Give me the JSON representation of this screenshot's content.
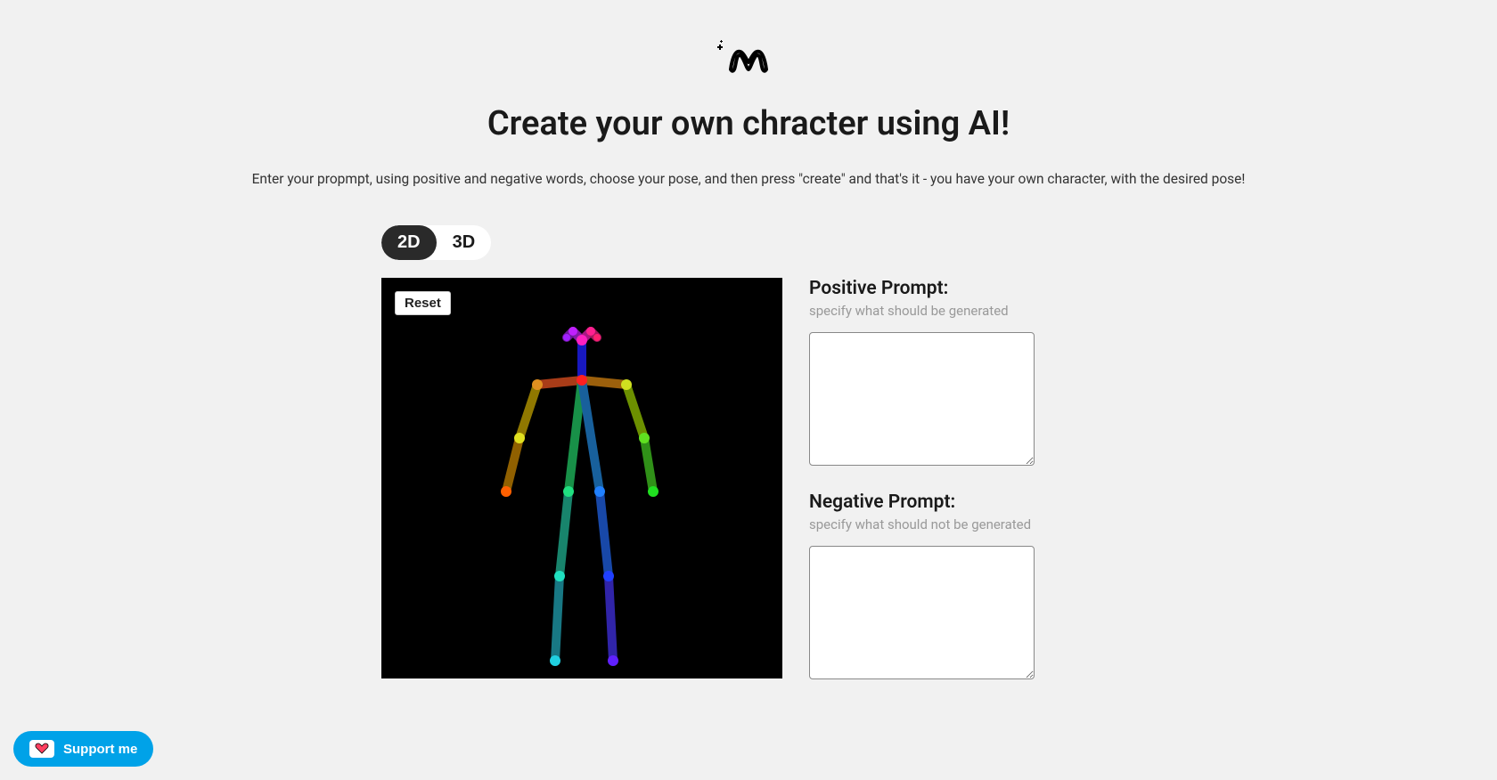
{
  "header": {
    "title": "Create your own chracter using AI!",
    "subtitle": "Enter your propmpt, using positive and negative words, choose your pose, and then press \"create\" and that's it - you have your own character, with the desired pose!"
  },
  "toggle": {
    "option_2d": "2D",
    "option_3d": "3D",
    "active": "2D"
  },
  "canvas": {
    "reset_label": "Reset"
  },
  "positive": {
    "label": "Positive Prompt:",
    "hint": "specify what should be generated",
    "value": ""
  },
  "negative": {
    "label": "Negative Prompt:",
    "hint": "specify what should not be generated",
    "value": ""
  },
  "support": {
    "label": "Support me"
  }
}
